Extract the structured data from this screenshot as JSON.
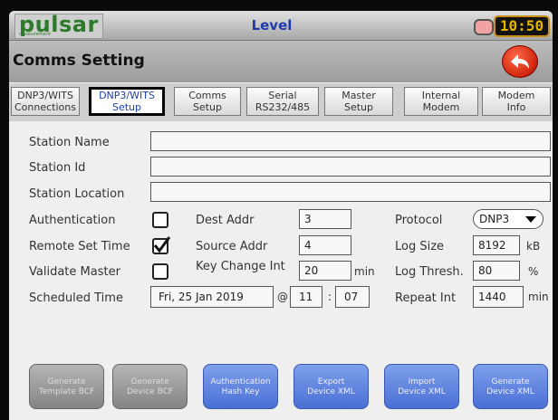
{
  "header": {
    "logo": "pulsar",
    "logo_sub": "measurement",
    "title": "Level",
    "clock": "10:50"
  },
  "page": {
    "title": "Comms Setting",
    "back_icon": "back-arrow-icon"
  },
  "tabs": [
    {
      "line1": "DNP3/WITS",
      "line2": "Connections"
    },
    {
      "line1": "DNP3/WITS",
      "line2": "Setup"
    },
    {
      "line1": "Comms",
      "line2": "Setup"
    },
    {
      "line1": "Serial",
      "line2": "RS232/485"
    },
    {
      "line1": "Master",
      "line2": "Setup"
    },
    {
      "line1": "Internal",
      "line2": "Modem"
    },
    {
      "line1": "Modem",
      "line2": "Info"
    }
  ],
  "active_tab": 1,
  "form": {
    "station_name_label": "Station Name",
    "station_name": "",
    "station_id_label": "Station Id",
    "station_id": "",
    "station_location_label": "Station Location",
    "station_location": "",
    "authentication_label": "Authentication",
    "authentication": false,
    "remote_set_time_label": "Remote Set Time",
    "remote_set_time": true,
    "validate_master_label": "Validate Master",
    "validate_master": false,
    "scheduled_time_label": "Scheduled Time",
    "scheduled_date": "Fri, 25 Jan 2019",
    "at": "@",
    "scheduled_hour": "11",
    "colon": ":",
    "scheduled_min": "07",
    "dest_addr_label": "Dest Addr",
    "dest_addr": "3",
    "source_addr_label": "Source Addr",
    "source_addr": "4",
    "key_change_int_label": "Key Change Int",
    "key_change_int": "20",
    "key_change_unit": "min",
    "protocol_label": "Protocol",
    "protocol": "DNP3",
    "log_size_label": "Log Size",
    "log_size": "8192",
    "log_size_unit": "kB",
    "log_thresh_label": "Log Thresh.",
    "log_thresh": "80",
    "log_thresh_unit": "%",
    "repeat_int_label": "Repeat Int",
    "repeat_int": "1440",
    "repeat_int_unit": "min"
  },
  "buttons": [
    {
      "line1": "Generate",
      "line2": "Template BCF",
      "style": "grey"
    },
    {
      "line1": "Generate",
      "line2": "Device BCF",
      "style": "grey"
    },
    {
      "line1": "Authentication",
      "line2": "Hash Key",
      "style": "blue"
    },
    {
      "line1": "Export",
      "line2": "Device XML",
      "style": "blue"
    },
    {
      "line1": "Import",
      "line2": "Device XML",
      "style": "blue"
    },
    {
      "line1": "Generate",
      "line2": "Device XML",
      "style": "blue"
    }
  ],
  "colors": {
    "title_blue": "#1f3aa8",
    "button_blue": "#5a7fe0",
    "button_grey": "#9a9a9a",
    "clock_amber": "#e3b400"
  }
}
